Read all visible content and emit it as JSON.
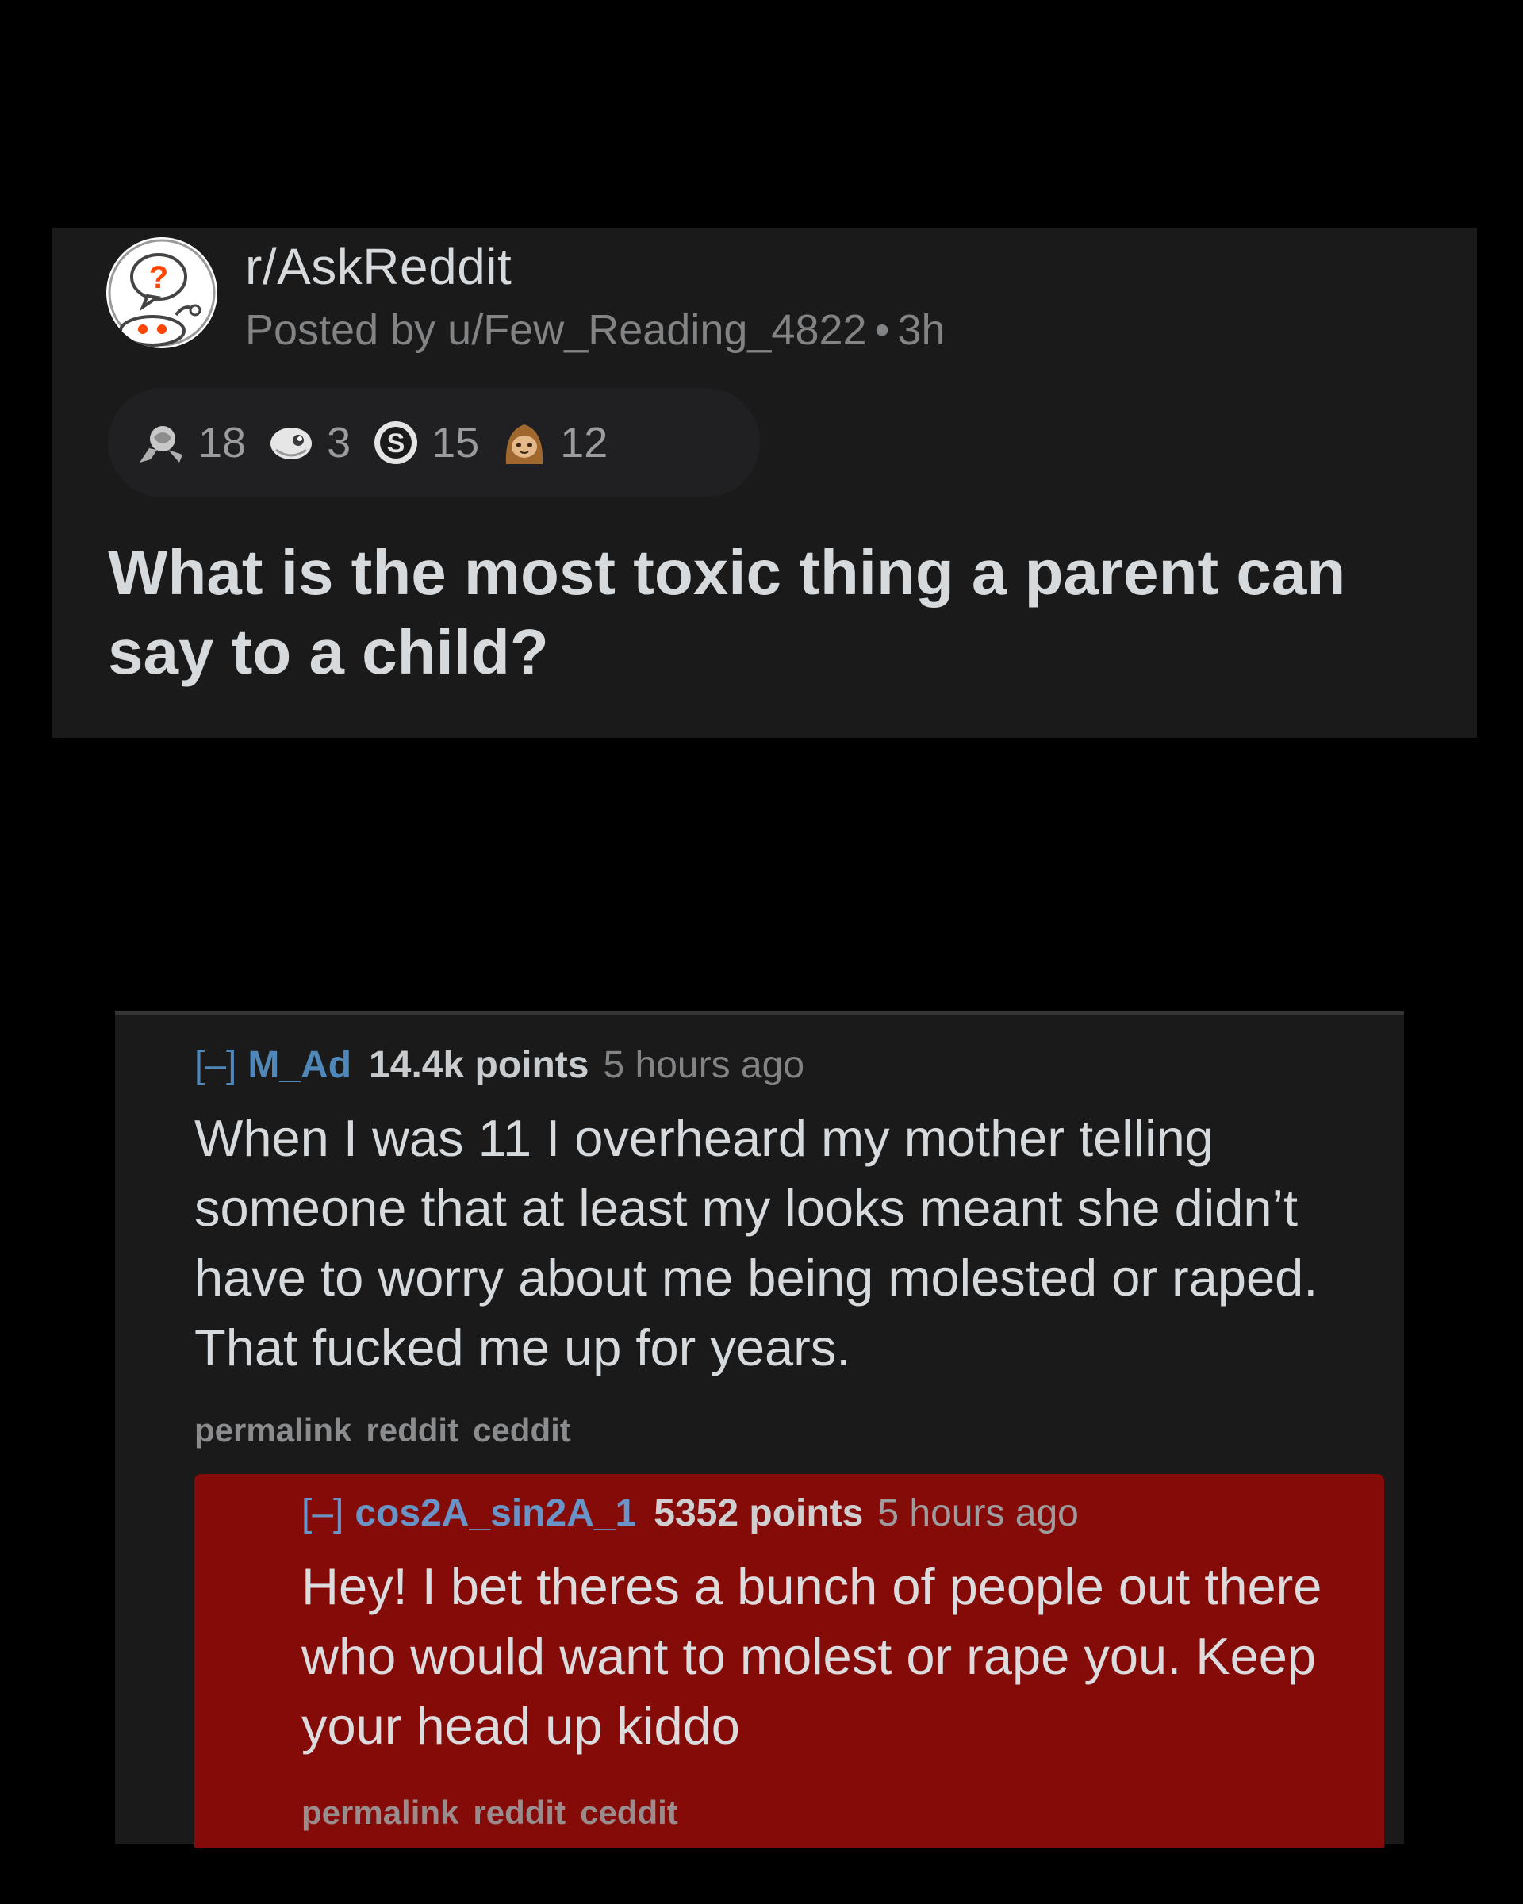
{
  "post": {
    "subreddit": "r/AskReddit",
    "posted_by": "Posted by u/Few_Reading_4822",
    "separator": "•",
    "age": "3h",
    "avatar_icon": "askreddit-snoo-icon",
    "awards": [
      {
        "icon": "silver-award-icon",
        "count": "18"
      },
      {
        "icon": "helpful-award-icon",
        "count": "3"
      },
      {
        "icon": "s-coin-award-icon",
        "count": "15"
      },
      {
        "icon": "sloth-award-icon",
        "count": "12"
      }
    ],
    "title": "What is the most toxic thing a parent can say to a child?"
  },
  "comment": {
    "toggle": "[–]",
    "author": "M_Ad",
    "points": "14.4k points",
    "age": "5 hours ago",
    "body": "When I was 11 I overheard my mother telling someone that at least my looks meant she didn’t have to worry about me being molested or raped. That fucked me up for years.",
    "links": [
      "permalink",
      "reddit",
      "ceddit"
    ]
  },
  "reply": {
    "toggle": "[–]",
    "author": "cos2A_sin2A_1",
    "points": "5352 points",
    "age": "5 hours ago",
    "body": "Hey! I bet theres a bunch of people out there who would want to molest or rape you. Keep your head up kiddo",
    "links": [
      "permalink",
      "reddit",
      "ceddit"
    ],
    "highlight_color": "#840b08"
  },
  "colors": {
    "background": "#000000",
    "card": "#1a1a1b",
    "username": "#4f87b8",
    "text": "#d7dadc",
    "muted": "#818384"
  }
}
